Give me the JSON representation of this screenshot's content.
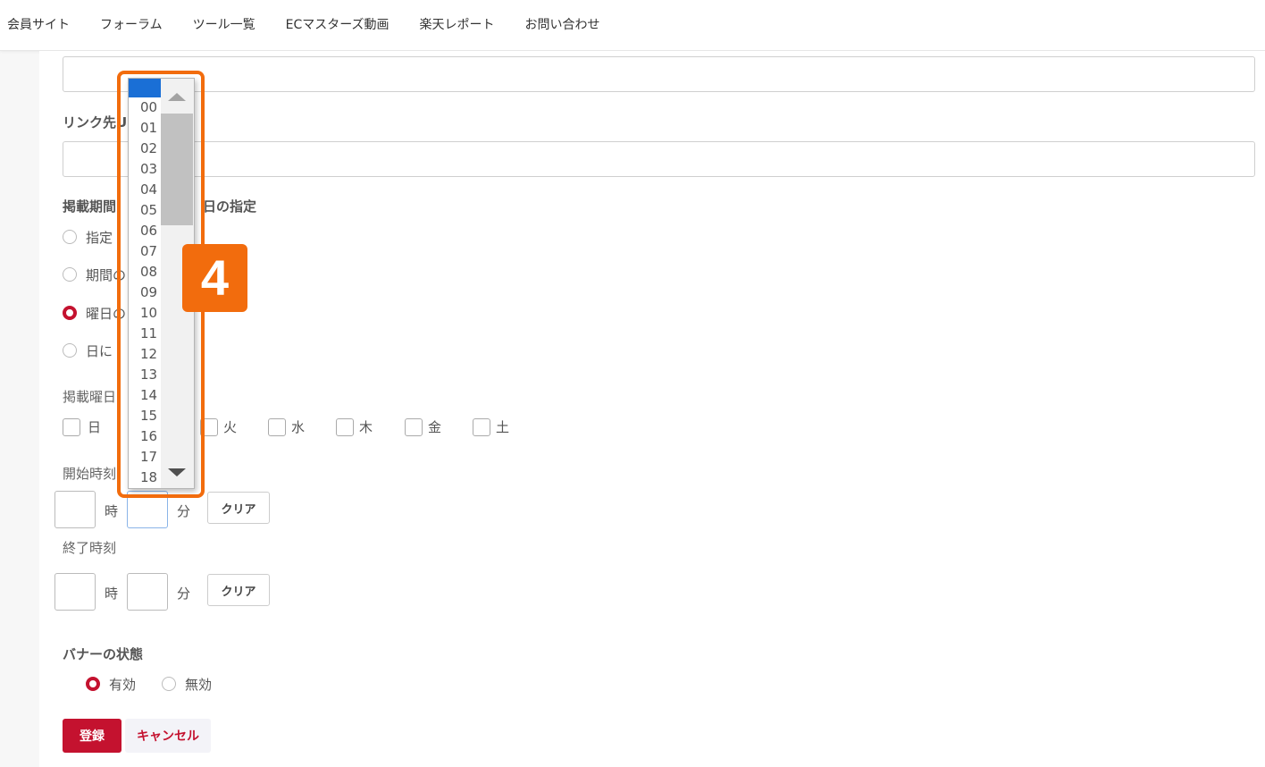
{
  "nav": {
    "items": [
      "会員サイト",
      "フォーラム",
      "ツール一覧",
      "ECマスターズ動画",
      "楽天レポート",
      "お問い合わせ"
    ]
  },
  "form": {
    "link_label": "リンク先U",
    "period_label": "掲載期間",
    "period_label_suffix": "日の指定",
    "period_options": [
      "指定",
      "期間の",
      "曜日の",
      "日に"
    ],
    "period_checked_index": 2,
    "weekday_label": "掲載曜日",
    "weekdays": [
      "日",
      "火",
      "水",
      "木",
      "金",
      "土"
    ],
    "start_time_label": "開始時刻",
    "end_time_label": "終了時刻",
    "hour_unit": "時",
    "minute_unit": "分",
    "clear_label": "クリア",
    "banner_state_label": "バナーの状態",
    "banner_state_options": [
      "有効",
      "無効"
    ],
    "banner_state_checked": "有効",
    "submit_label": "登録",
    "cancel_label": "キャンセル"
  },
  "dropdown": {
    "options": [
      "00",
      "01",
      "02",
      "03",
      "04",
      "05",
      "06",
      "07",
      "08",
      "09",
      "10",
      "11",
      "12",
      "13",
      "14",
      "15",
      "16",
      "17",
      "18"
    ]
  },
  "annotation": {
    "step_number": "4",
    "color": "#f26c0d"
  },
  "colors": {
    "accent": "#c4122f",
    "selection": "#1a6fd6"
  }
}
